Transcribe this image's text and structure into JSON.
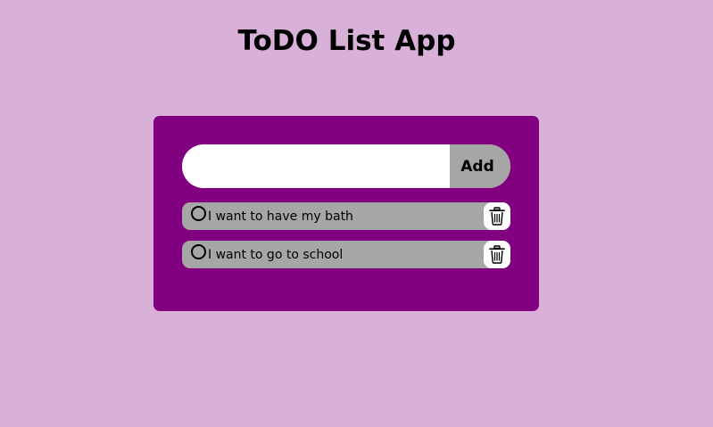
{
  "app": {
    "title": "ToDO List App"
  },
  "form": {
    "input_value": "",
    "input_placeholder": "",
    "add_label": "Add"
  },
  "todos": [
    {
      "text": "I want to have my bath",
      "completed": false
    },
    {
      "text": "I want to go to school",
      "completed": false
    }
  ],
  "icons": {
    "check": "circle-icon",
    "delete": "trash-icon"
  },
  "colors": {
    "background": "#d8b0d8",
    "panel": "#800080",
    "item": "#a6a6a6",
    "input": "#ffffff"
  }
}
